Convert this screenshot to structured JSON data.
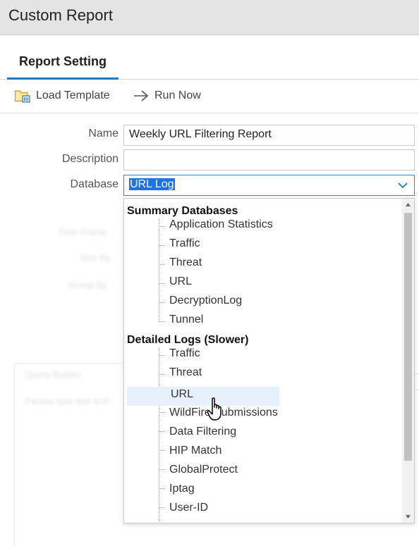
{
  "window": {
    "title": "Custom Report"
  },
  "tabs": [
    {
      "label": "Report Setting",
      "active": true
    }
  ],
  "toolbar": {
    "load_template": {
      "label": "Load Template",
      "icon": "folder-template-icon"
    },
    "run_now": {
      "label": "Run Now",
      "icon": "arrow-right-icon"
    }
  },
  "form": {
    "name": {
      "label": "Name",
      "value": "Weekly URL Filtering Report"
    },
    "description": {
      "label": "Description",
      "value": ""
    },
    "database": {
      "label": "Database",
      "value": "URL Log"
    }
  },
  "dropdown": {
    "groups": [
      {
        "label": "Summary Databases",
        "items": [
          "Application Statistics",
          "Traffic",
          "Threat",
          "URL",
          "DecryptionLog",
          "Tunnel"
        ]
      },
      {
        "label": "Detailed Logs (Slower)",
        "items": [
          "Traffic",
          "Threat",
          "URL",
          "WildFire Submissions",
          "Data Filtering",
          "HIP Match",
          "GlobalProtect",
          "Iptag",
          "User-ID"
        ]
      }
    ],
    "hovered": "URL"
  },
  "background": {
    "time_frame": "Time Frame",
    "sort_by": "Sort By",
    "group_by": "Group By",
    "query_builder": "Query Builder",
    "query_hint": "Please type text and"
  },
  "colors": {
    "accent": "#1d7cc0",
    "selection": "#1a73e8",
    "hover": "#e6f1fb"
  }
}
